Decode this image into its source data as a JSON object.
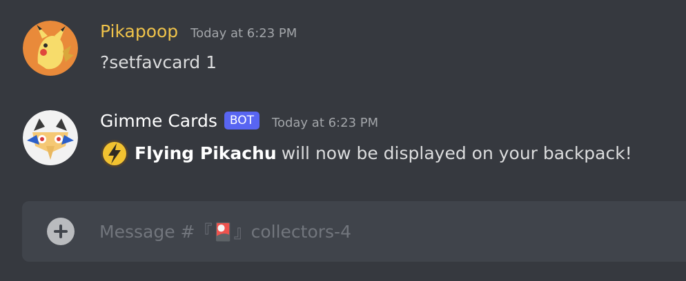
{
  "messages": [
    {
      "author": "Pikapoop",
      "author_color": "#f0c34a",
      "avatar_icon": "pikachu-avatar-icon",
      "timestamp": "Today at 6:23 PM",
      "content": "?setfavcard 1"
    },
    {
      "author": "Gimme Cards",
      "author_color": "#ffffff",
      "bot_badge": "BOT",
      "avatar_icon": "gimme-cards-bot-avatar-icon",
      "timestamp": "Today at 6:23 PM",
      "content_emoji": "lightning-badge-icon",
      "content_bold": "Flying Pikachu",
      "content_rest": "will now be displayed on your backpack!"
    }
  ],
  "composer": {
    "placeholder": "Message #『🎴』collectors-4",
    "value": "",
    "add_icon": "plus-circle-icon"
  },
  "colors": {
    "background": "#36393f",
    "composer": "#40444b",
    "bot_badge": "#5865f2",
    "timestamp": "#a3a6aa",
    "text": "#dcddde"
  }
}
